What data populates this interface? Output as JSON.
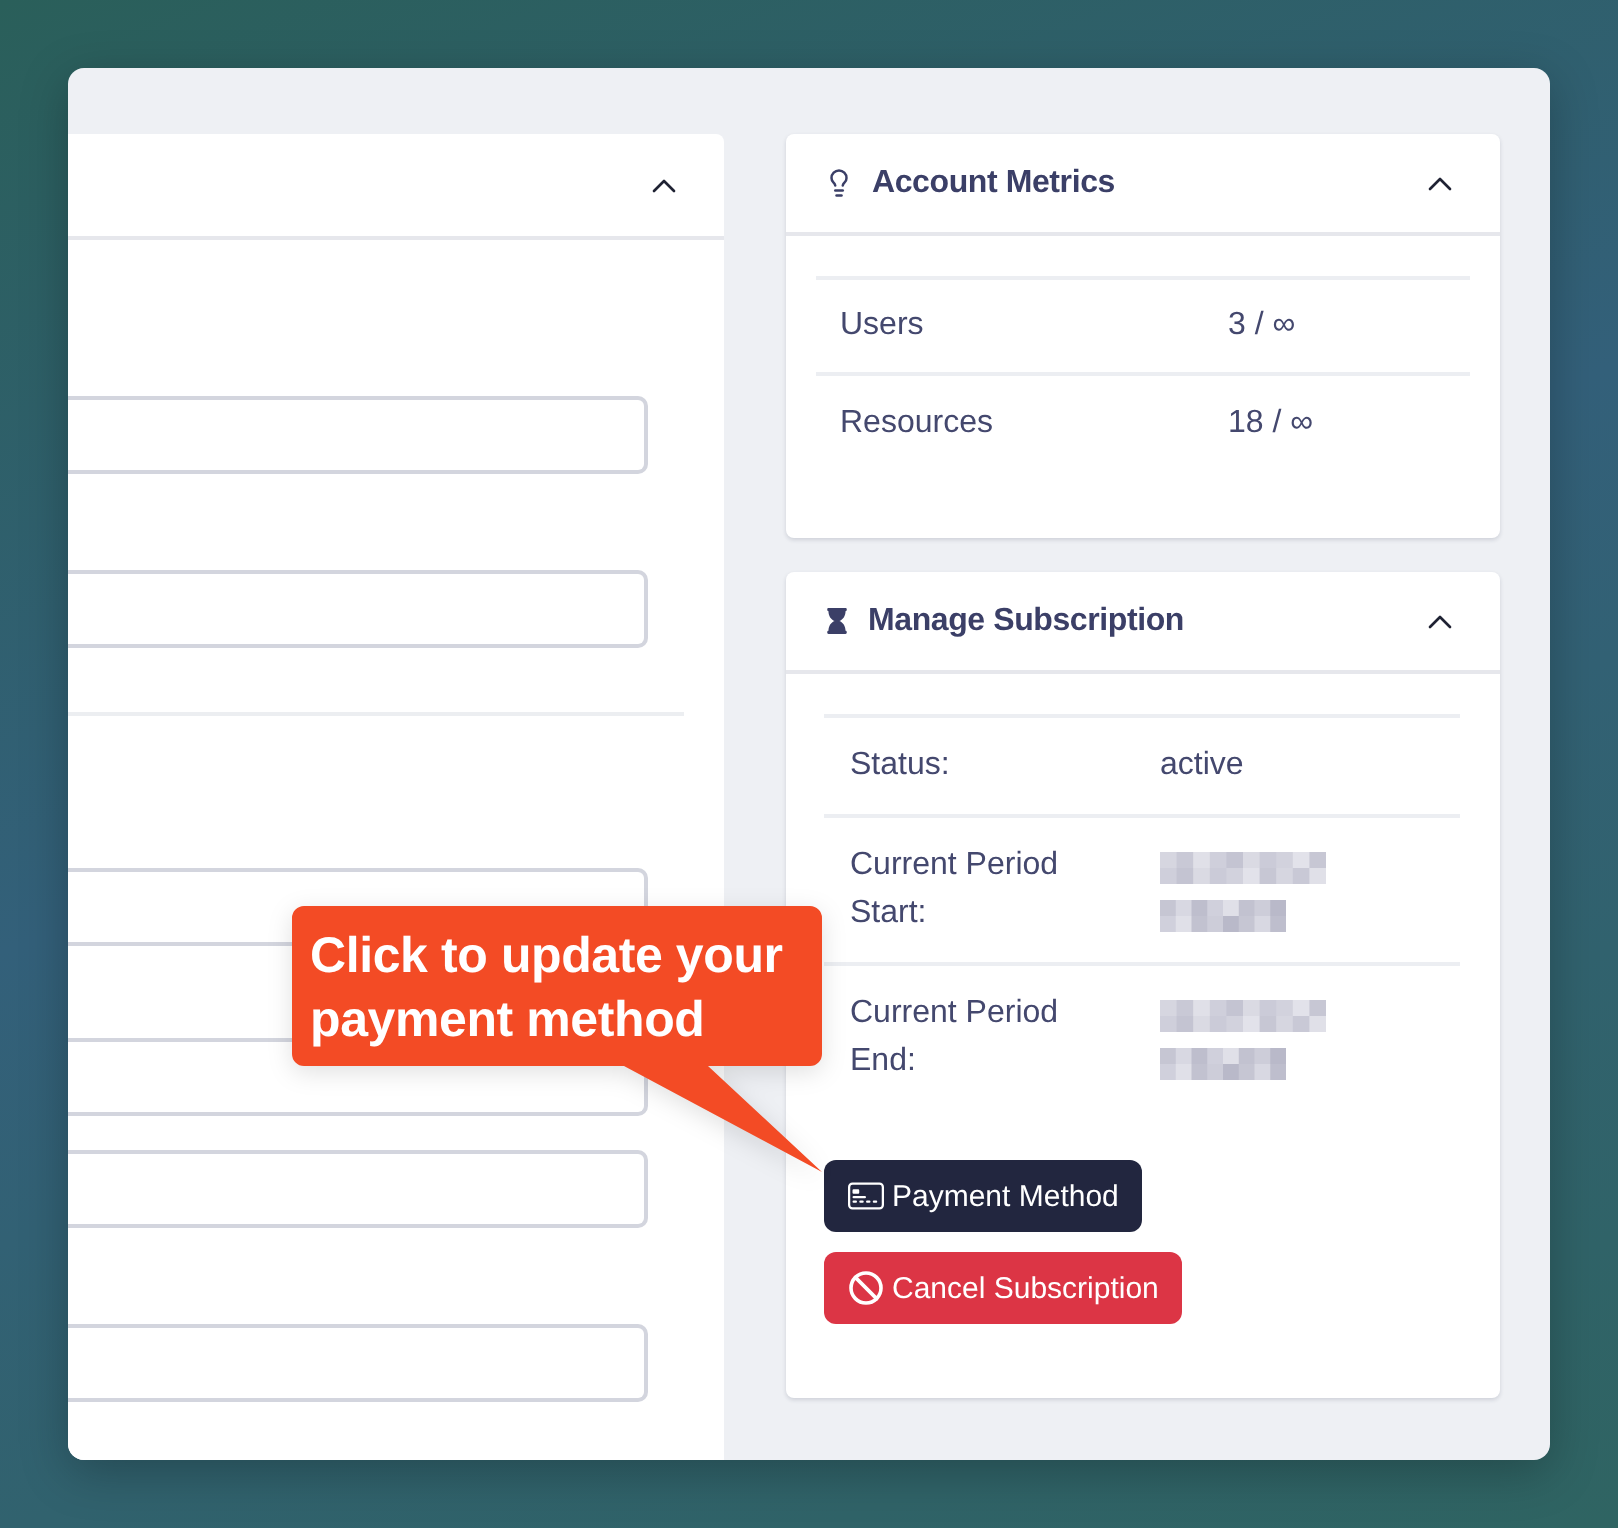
{
  "form_panel": {
    "expanded": true,
    "sections": [
      {
        "fields": [
          {
            "kind": "input"
          },
          {
            "kind": "input"
          }
        ]
      },
      {
        "fields": [
          {
            "kind": "input"
          },
          {
            "kind": "textarea"
          },
          {
            "kind": "input"
          },
          {
            "kind": "input"
          },
          {
            "kind": "input"
          }
        ]
      }
    ]
  },
  "metrics_card": {
    "title": "Account Metrics",
    "expanded": true,
    "rows": [
      {
        "label": "Users",
        "value": "3 / ∞"
      },
      {
        "label": "Resources",
        "value": "18 / ∞"
      }
    ]
  },
  "subscription_card": {
    "title": "Manage Subscription",
    "expanded": true,
    "rows": [
      {
        "label": "Status:",
        "redacted": false,
        "value": "active"
      },
      {
        "label": "Current Period Start:",
        "redacted": true
      },
      {
        "label": "Current Period End:",
        "redacted": true
      }
    ],
    "buttons": [
      {
        "kind": "primary",
        "label": "Payment Method"
      },
      {
        "kind": "danger",
        "label": "Cancel Subscription"
      }
    ]
  },
  "callout": {
    "text": "Click to update your payment method"
  }
}
